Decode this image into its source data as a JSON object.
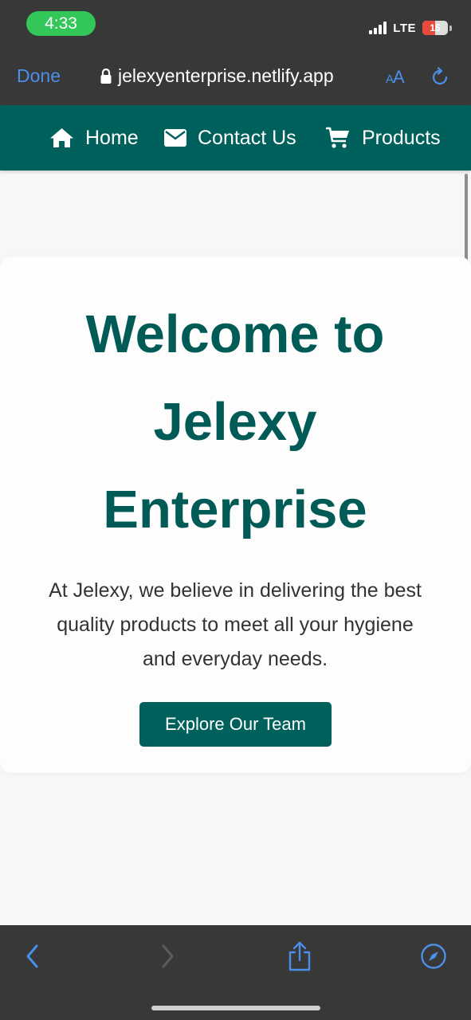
{
  "status_bar": {
    "time": "4:33",
    "network": "LTE",
    "battery": "15",
    "battery_level_percent": 15
  },
  "browser": {
    "done_label": "Done",
    "url": "jelexyenterprise.netlify.app",
    "text_size_label": "AA",
    "lock_icon": "lock-icon",
    "reload_icon": "reload-icon"
  },
  "nav": {
    "items": [
      {
        "label": "Home",
        "icon": "home-icon"
      },
      {
        "label": "Contact Us",
        "icon": "envelope-icon"
      },
      {
        "label": "Products",
        "icon": "cart-icon"
      }
    ]
  },
  "hero": {
    "title": "Welcome to Jelexy Enterprise",
    "text": "At Jelexy, we believe in delivering the best quality products to meet all your hygiene and everyday needs.",
    "button_label": "Explore Our Team"
  },
  "toolbar": {
    "icons": [
      "back-icon",
      "forward-icon",
      "share-icon",
      "compass-icon"
    ]
  },
  "colors": {
    "brand": "#00605b",
    "title": "#005a55",
    "chrome": "#383838",
    "accent": "#4a8fe8",
    "status_green": "#33c759"
  }
}
